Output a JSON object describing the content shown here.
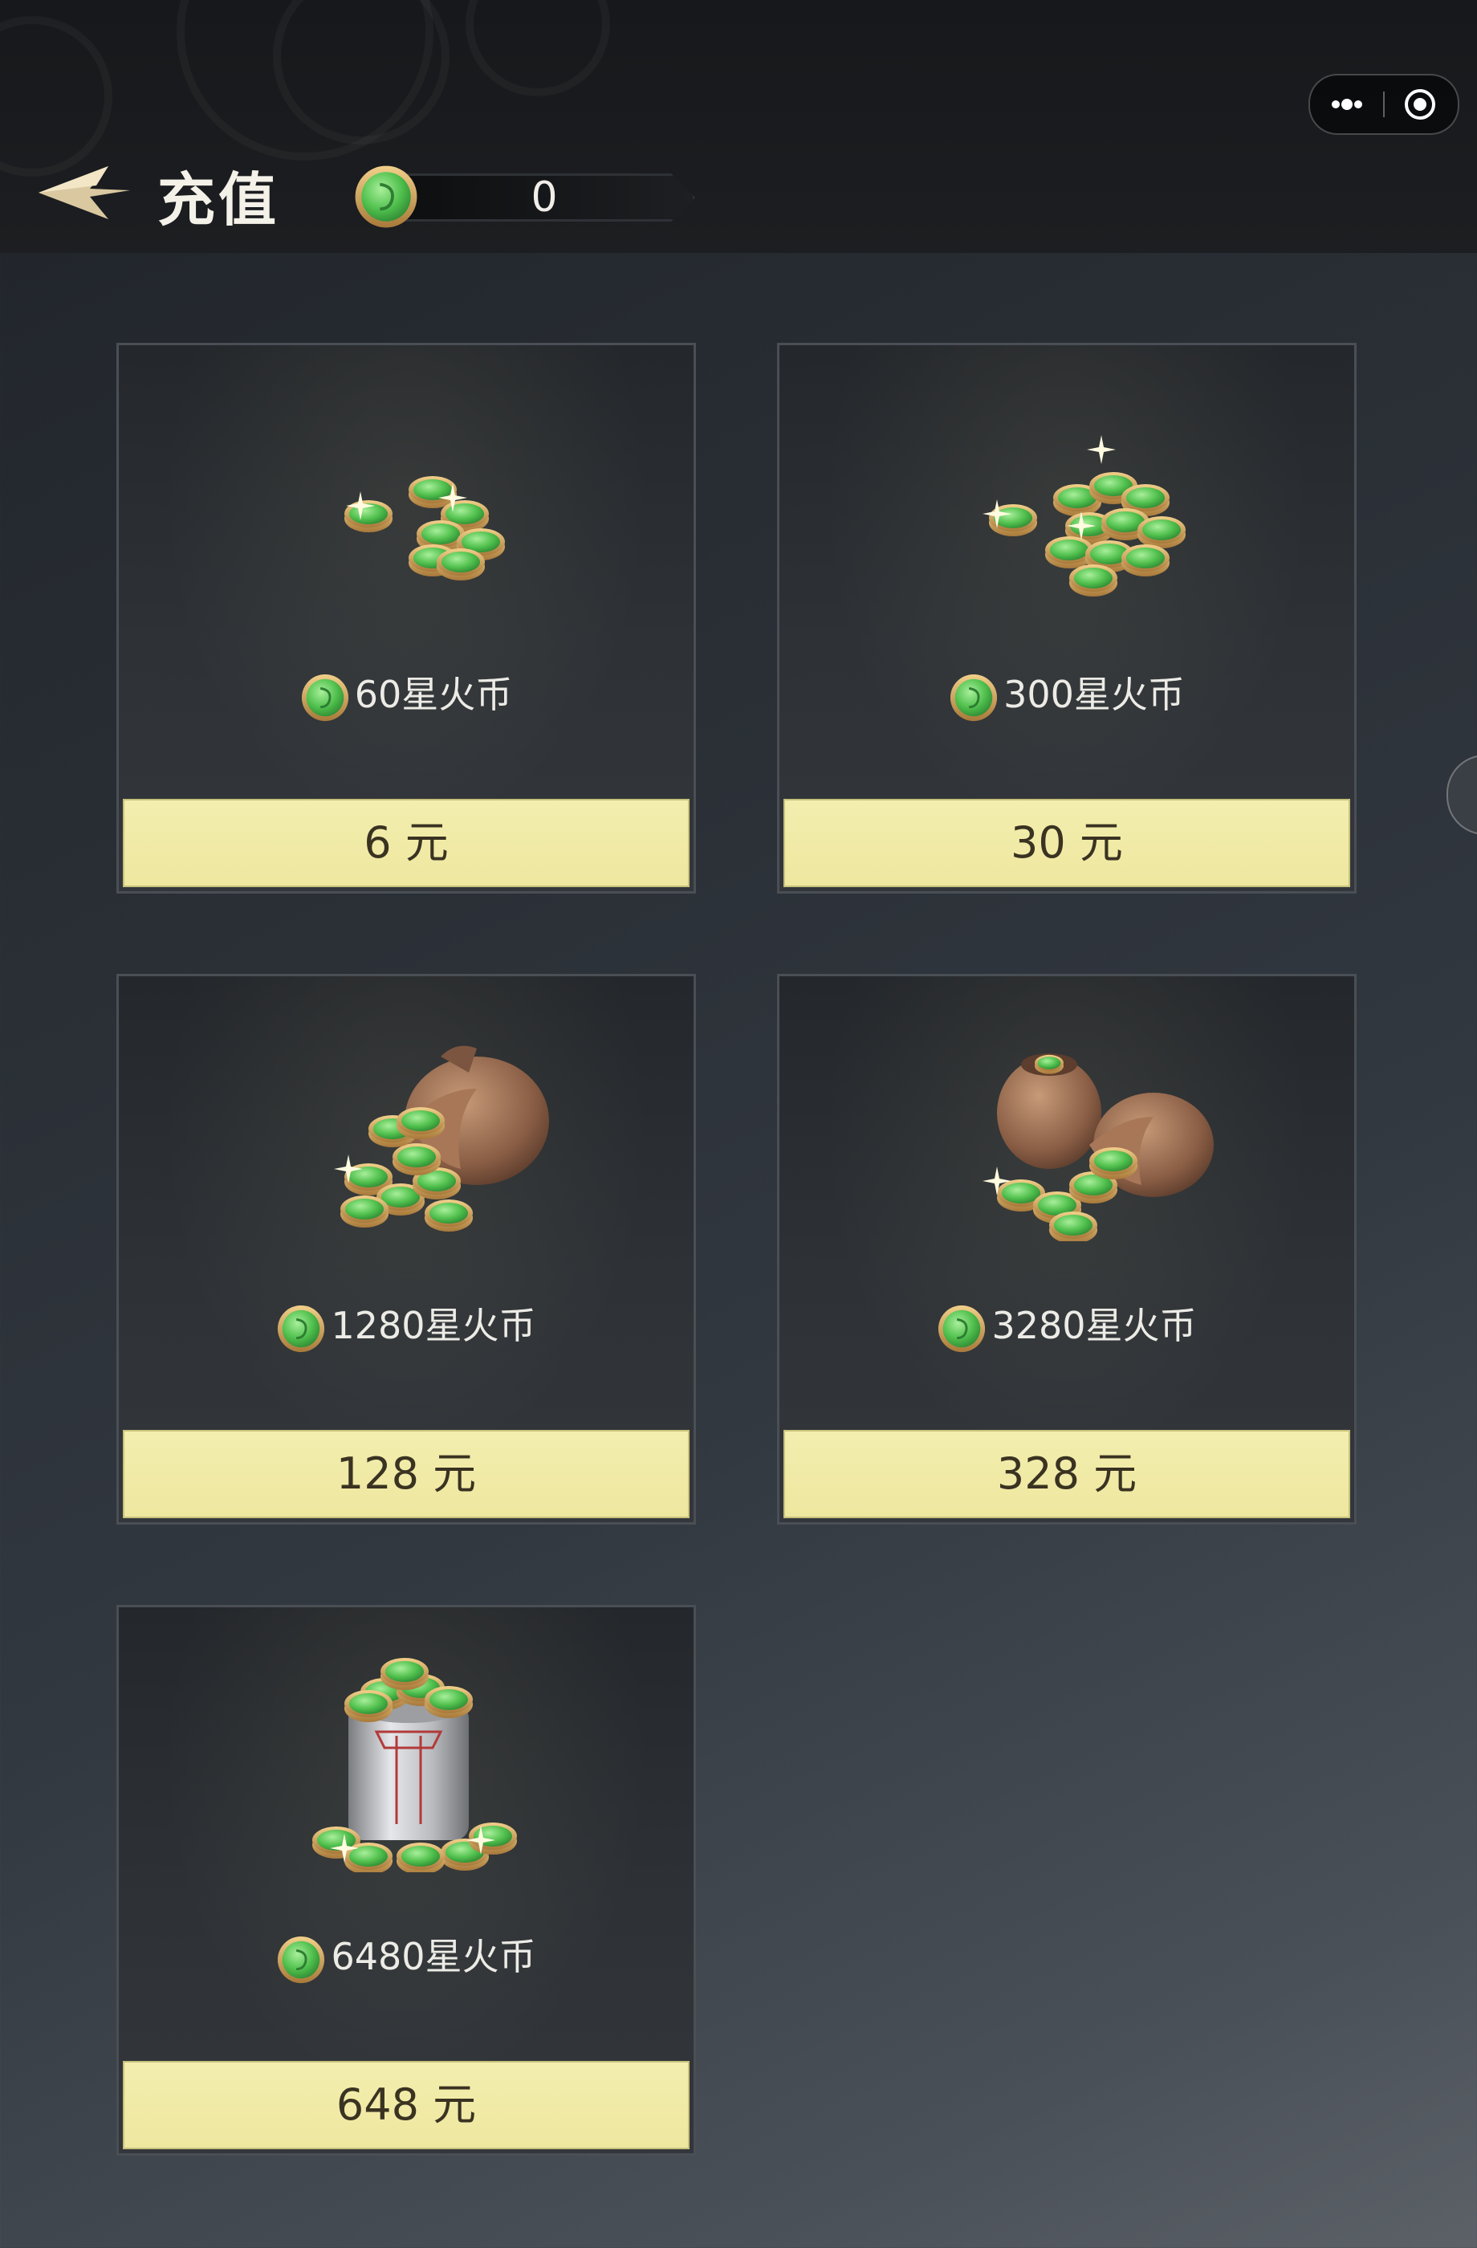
{
  "header": {
    "title": "充值",
    "balance": "0",
    "back_icon": "back-arrow-icon",
    "currency_icon": "green-coin-icon"
  },
  "capsule": {
    "more_icon": "more-dots-icon",
    "close_icon": "target-close-icon"
  },
  "products": [
    {
      "coins": "60星火币",
      "price": "6 元",
      "art": "small-coin-pile"
    },
    {
      "coins": "300星火币",
      "price": "30 元",
      "art": "coin-pile"
    },
    {
      "coins": "1280星火币",
      "price": "128 元",
      "art": "coin-bag"
    },
    {
      "coins": "3280星火币",
      "price": "328 元",
      "art": "two-coin-bags"
    },
    {
      "coins": "6480星火币",
      "price": "648 元",
      "art": "coin-canister"
    }
  ],
  "colors": {
    "coin_green": "#5ec85a",
    "coin_rim": "#c99a4a",
    "price_bg": "#f1ebaa",
    "card_border": "#4a4e55"
  }
}
